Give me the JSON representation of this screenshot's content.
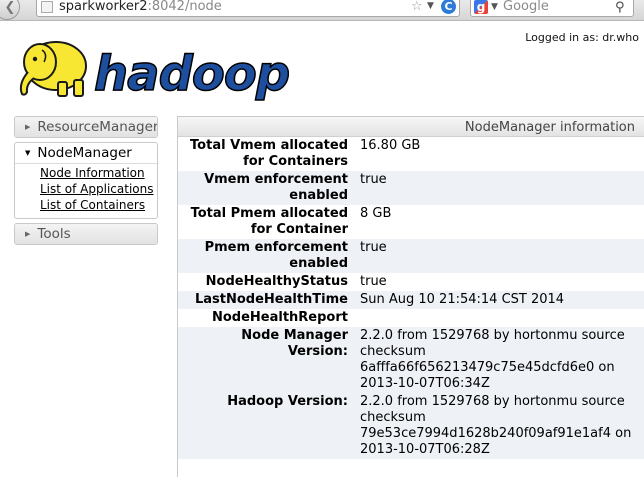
{
  "browser": {
    "url_host": "sparkworker2",
    "url_rest": ":8042/node",
    "search_placeholder": "Google"
  },
  "header": {
    "logged_in": "Logged in as: dr.who",
    "logo_text": "hadoop"
  },
  "nav": {
    "resource_manager": "ResourceManager",
    "node_manager": "NodeManager",
    "links": [
      "Node Information",
      "List of Applications",
      "List of Containers"
    ],
    "tools": "Tools"
  },
  "info": {
    "title": "NodeManager information",
    "rows": [
      {
        "key": "Total Vmem allocated for Containers",
        "value": "16.80 GB"
      },
      {
        "key": "Vmem enforcement enabled",
        "value": "true"
      },
      {
        "key": "Total Pmem allocated for Container",
        "value": "8 GB"
      },
      {
        "key": "Pmem enforcement enabled",
        "value": "true"
      },
      {
        "key": "NodeHealthyStatus",
        "value": "true"
      },
      {
        "key": "LastNodeHealthTime",
        "value": "Sun Aug 10 21:54:14 CST 2014"
      },
      {
        "key": "NodeHealthReport",
        "value": ""
      },
      {
        "key": "Node Manager Version:",
        "value": "2.2.0 from 1529768 by hortonmu source checksum 6afffa66f656213479c75e45dcfd6e0 on 2013-10-07T06:34Z"
      },
      {
        "key": "Hadoop Version:",
        "value": "2.2.0 from 1529768 by hortonmu source checksum 79e53ce7994d1628b240f09af91e1af4 on 2013-10-07T06:28Z"
      }
    ]
  }
}
